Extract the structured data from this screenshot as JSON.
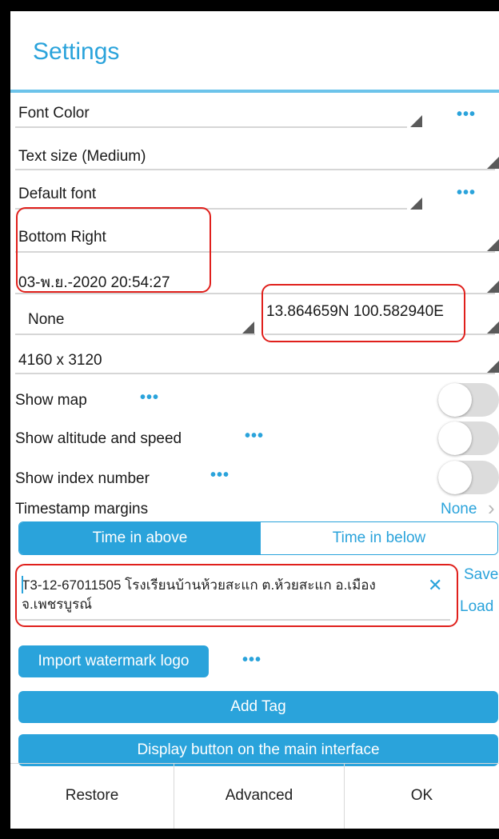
{
  "dialog": {
    "title": "Settings"
  },
  "rows": {
    "font_color": "Font Color",
    "text_size": "Text size (Medium)",
    "default_font": "Default font",
    "position": "Bottom Right",
    "date_time": "03-พ.ย.-2020 20:54:27",
    "location_mode": "None",
    "coordinates": "13.864659N 100.582940E",
    "resolution": "4160 x 3120"
  },
  "more_dots": "•••",
  "toggles": [
    {
      "label": "Show map",
      "state": "off"
    },
    {
      "label": "Show altitude and speed",
      "state": "off"
    },
    {
      "label": "Show index number",
      "state": "off"
    }
  ],
  "margins": {
    "label": "Timestamp margins",
    "value": "None",
    "arrow": "›"
  },
  "segments": {
    "active": "Time in above",
    "inactive": "Time in below"
  },
  "note": {
    "text": "T3-12-67011505 โรงเรียนบ้านห้วยสะแก ต.ห้วยสะแก อ.เมือง จ.เพชรบูรณ์",
    "clear_symbol": "✕",
    "save": "Save",
    "load": "Load"
  },
  "buttons": {
    "import_logo": "Import watermark logo",
    "add_tag": "Add Tag",
    "display_button": "Display button on the main interface"
  },
  "footer": {
    "restore": "Restore",
    "advanced": "Advanced",
    "ok": "OK"
  },
  "colors": {
    "accent": "#2aa3db",
    "highlight": "#e0201c",
    "toggle_track": "#dcdcdc"
  }
}
